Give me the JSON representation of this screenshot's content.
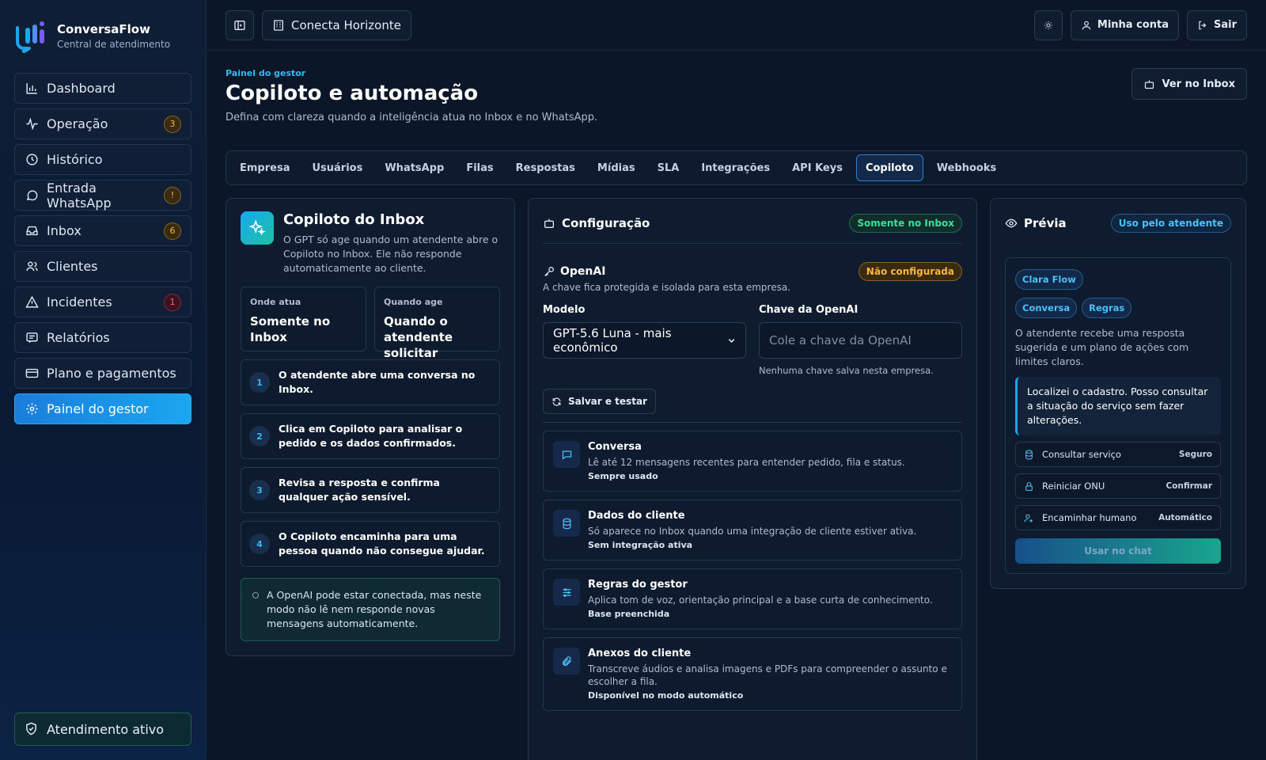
{
  "brand": {
    "name": "ConversaFlow",
    "subtitle": "Central de atendimento"
  },
  "sidebar": {
    "items": [
      {
        "label": "Dashboard",
        "icon": "bar-chart-icon"
      },
      {
        "label": "Operação",
        "icon": "activity-icon",
        "badge": "3"
      },
      {
        "label": "Histórico",
        "icon": "clock-icon"
      },
      {
        "label": "Entrada WhatsApp",
        "icon": "chat-bubble-icon",
        "badge": "!"
      },
      {
        "label": "Inbox",
        "icon": "inbox-icon",
        "badge": "6"
      },
      {
        "label": "Clientes",
        "icon": "users-icon"
      },
      {
        "label": "Incidentes",
        "icon": "warning-icon",
        "badge": "1"
      },
      {
        "label": "Relatórios",
        "icon": "report-icon"
      },
      {
        "label": "Plano e pagamentos",
        "icon": "credit-card-icon"
      },
      {
        "label": "Painel do gestor",
        "icon": "gear-icon",
        "active": true
      }
    ],
    "footer": "Atendimento ativo"
  },
  "topbar": {
    "workspace": "Conecta Horizonte",
    "account": "Minha conta",
    "logout": "Sair"
  },
  "page": {
    "eyebrow": "Painel do gestor",
    "title": "Copiloto e automação",
    "description": "Defina com clareza quando a inteligência atua no Inbox e no WhatsApp.",
    "view_inbox": "Ver no Inbox"
  },
  "tabs": [
    "Empresa",
    "Usuários",
    "WhatsApp",
    "Filas",
    "Respostas",
    "Mídias",
    "SLA",
    "Integrações",
    "API Keys",
    "Copiloto",
    "Webhooks"
  ],
  "active_tab": "Copiloto",
  "inbox_copilot": {
    "title": "Copiloto do Inbox",
    "description": "O GPT só age quando um atendente abre o Copiloto no Inbox. Ele não responde automaticamente ao cliente.",
    "where_label": "Onde atua",
    "where_value": "Somente no Inbox",
    "when_label": "Quando age",
    "when_value": "Quando o atendente solicitar",
    "steps": [
      {
        "num": "1",
        "text": "O atendente abre uma conversa no Inbox."
      },
      {
        "num": "2",
        "text": "Clica em Copiloto para analisar o pedido e os dados confirmados."
      },
      {
        "num": "3",
        "text": "Revisa a resposta e confirma qualquer ação sensível."
      },
      {
        "num": "4",
        "text": "O Copiloto encaminha para uma pessoa quando não consegue ajudar."
      }
    ],
    "note": "A OpenAI pode estar conectada, mas neste modo não lê nem responde novas mensagens automaticamente."
  },
  "config": {
    "title": "Configuração",
    "mode_pill": "Somente no Inbox",
    "openai_title": "OpenAI",
    "openai_status": "Não configurada",
    "openai_desc": "A chave fica protegida e isolada para esta empresa.",
    "model_label": "Modelo",
    "model_value": "GPT-5.6 Luna - mais econômico",
    "key_label": "Chave da OpenAI",
    "key_placeholder": "Cole a chave da OpenAI",
    "key_hint": "Nenhuma chave salva nesta empresa.",
    "save_button": "Salvar e testar",
    "features": [
      {
        "icon": "chat-bubble-icon",
        "title": "Conversa",
        "desc": "Lê até 12 mensagens recentes para entender pedido, fila e status.",
        "meta": "Sempre usado"
      },
      {
        "icon": "database-icon",
        "title": "Dados do cliente",
        "desc": "Só aparece no Inbox quando uma integração de cliente estiver ativa.",
        "meta": "Sem integração ativa"
      },
      {
        "icon": "sliders-icon",
        "title": "Regras do gestor",
        "desc": "Aplica tom de voz, orientação principal e a base curta de conhecimento.",
        "meta": "Base preenchida"
      },
      {
        "icon": "paperclip-icon",
        "title": "Anexos do cliente",
        "desc": "Transcreve áudios e analisa imagens e PDFs para compreender o assunto e escolher a fila.",
        "meta": "Disponível no modo automático"
      }
    ]
  },
  "preview": {
    "title": "Prévia",
    "pill": "Uso pelo atendente",
    "agent_chip": "Clara Flow",
    "tags": [
      "Conversa",
      "Regras"
    ],
    "description": "O atendente recebe uma resposta sugerida e um plano de ações com limites claros.",
    "suggestion": "Localizei o cadastro. Posso consultar a situação do serviço sem fazer alterações.",
    "actions": [
      {
        "icon": "database-icon",
        "label": "Consultar serviço",
        "tag": "Seguro"
      },
      {
        "icon": "lock-icon",
        "label": "Reiniciar ONU",
        "tag": "Confirmar"
      },
      {
        "icon": "user-forward-icon",
        "label": "Encaminhar humano",
        "tag": "Automático"
      }
    ],
    "use_button": "Usar no chat"
  },
  "colors": {
    "accent": "#1aa7f0",
    "success": "#3ddca0",
    "warning": "#f6b63d",
    "danger": "#ff5e7e",
    "background": "#0b1628"
  }
}
